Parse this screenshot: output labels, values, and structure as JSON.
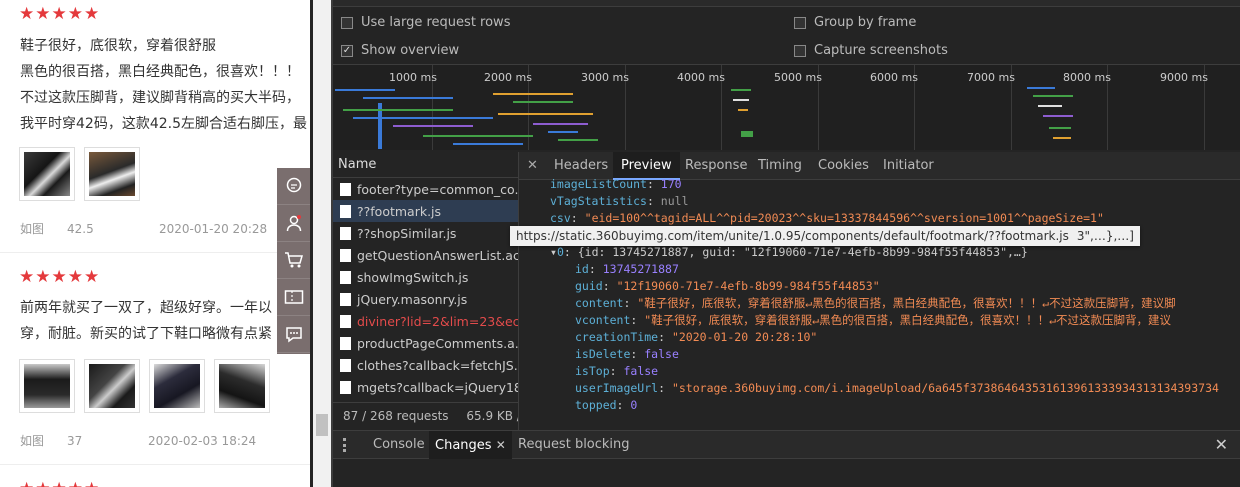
{
  "reviews": [
    {
      "stars": 5,
      "lines": [
        "鞋子很好，底很软，穿着很舒服",
        "黑色的很百搭，黑白经典配色，很喜欢！！！",
        "不过这款压脚背，建议脚背稍高的买大半码，",
        "我平时穿42码，这款42.5左脚合适右脚压，最"
      ],
      "label": "如图",
      "size": "42.5",
      "date": "2020-01-20 20:28"
    },
    {
      "stars": 5,
      "lines": [
        "前两年就买了一双了，超级好穿。一年以",
        "穿，耐脏。新买的试了下鞋口略微有点紧"
      ],
      "label": "如图",
      "size": "37",
      "date": "2020-02-03 18:24"
    }
  ],
  "devtools": {
    "options": {
      "large_rows": "Use large request rows",
      "show_overview": "Show overview",
      "group_by_frame": "Group by frame",
      "capture_screenshots": "Capture screenshots"
    },
    "timeline_ticks": [
      "1000 ms",
      "2000 ms",
      "3000 ms",
      "4000 ms",
      "5000 ms",
      "6000 ms",
      "7000 ms",
      "8000 ms",
      "9000 ms"
    ],
    "name_header": "Name",
    "requests": [
      {
        "name": "footer?type=common_co...",
        "color": "#cccccc"
      },
      {
        "name": "??footmark.js",
        "color": "#cccccc"
      },
      {
        "name": "??shopSimilar.js",
        "color": "#cccccc"
      },
      {
        "name": "getQuestionAnswerList.ac...",
        "color": "#cccccc"
      },
      {
        "name": "showImgSwitch.js",
        "color": "#cccccc"
      },
      {
        "name": "jQuery.masonry.js",
        "color": "#cccccc"
      },
      {
        "name": "diviner?lid=2&lim=23&ec...",
        "color": "#e34b4b"
      },
      {
        "name": "productPageComments.a...",
        "color": "#cccccc"
      },
      {
        "name": "clothes?callback=fetchJS...",
        "color": "#cccccc"
      },
      {
        "name": "mgets?callback=jQuery18...",
        "color": "#cccccc"
      }
    ],
    "status": {
      "requests": "87 / 268 requests",
      "size": "65.9 KB /"
    },
    "tabs": [
      "Headers",
      "Preview",
      "Response",
      "Timing",
      "Cookies",
      "Initiator"
    ],
    "preview": {
      "imageListCount": "170",
      "vTagStatistics": "null",
      "csv": "\"eid=100^^tagid=ALL^^pid=20023^^sku=13337844596^^sversion=1001^^pageSize=1\"",
      "row0_summary": "{id: 13745271887, guid: \"12f19060-71e7-4efb-8b99-984f55f44853\",…}",
      "tooltip_url": "https://static.360buyimg.com/item/unite/1.0.95/components/default/footmark/??footmark.js",
      "tooltip_tail": "3\",…},…]",
      "id": "13745271887",
      "guid": "\"12f19060-71e7-4efb-8b99-984f55f44853\"",
      "content": "\"鞋子很好，底很软，穿着很舒服↵黑色的很百搭，黑白经典配色，很喜欢！！！↵不过这款压脚背，建议脚",
      "vcontent": "\"鞋子很好，底很软，穿着很舒服↵黑色的很百搭，黑白经典配色，很喜欢！！！↵不过这款压脚背，建议",
      "creationTime": "\"2020-01-20 20:28:10\"",
      "isDelete": "false",
      "isTop": "false",
      "userImageUrl": "\"storage.360buyimg.com/i.imageUpload/6a645f373864643531613961333934313134393734",
      "topped": "0"
    },
    "drawer_tabs": [
      "Console",
      "Changes",
      "Request blocking"
    ]
  }
}
